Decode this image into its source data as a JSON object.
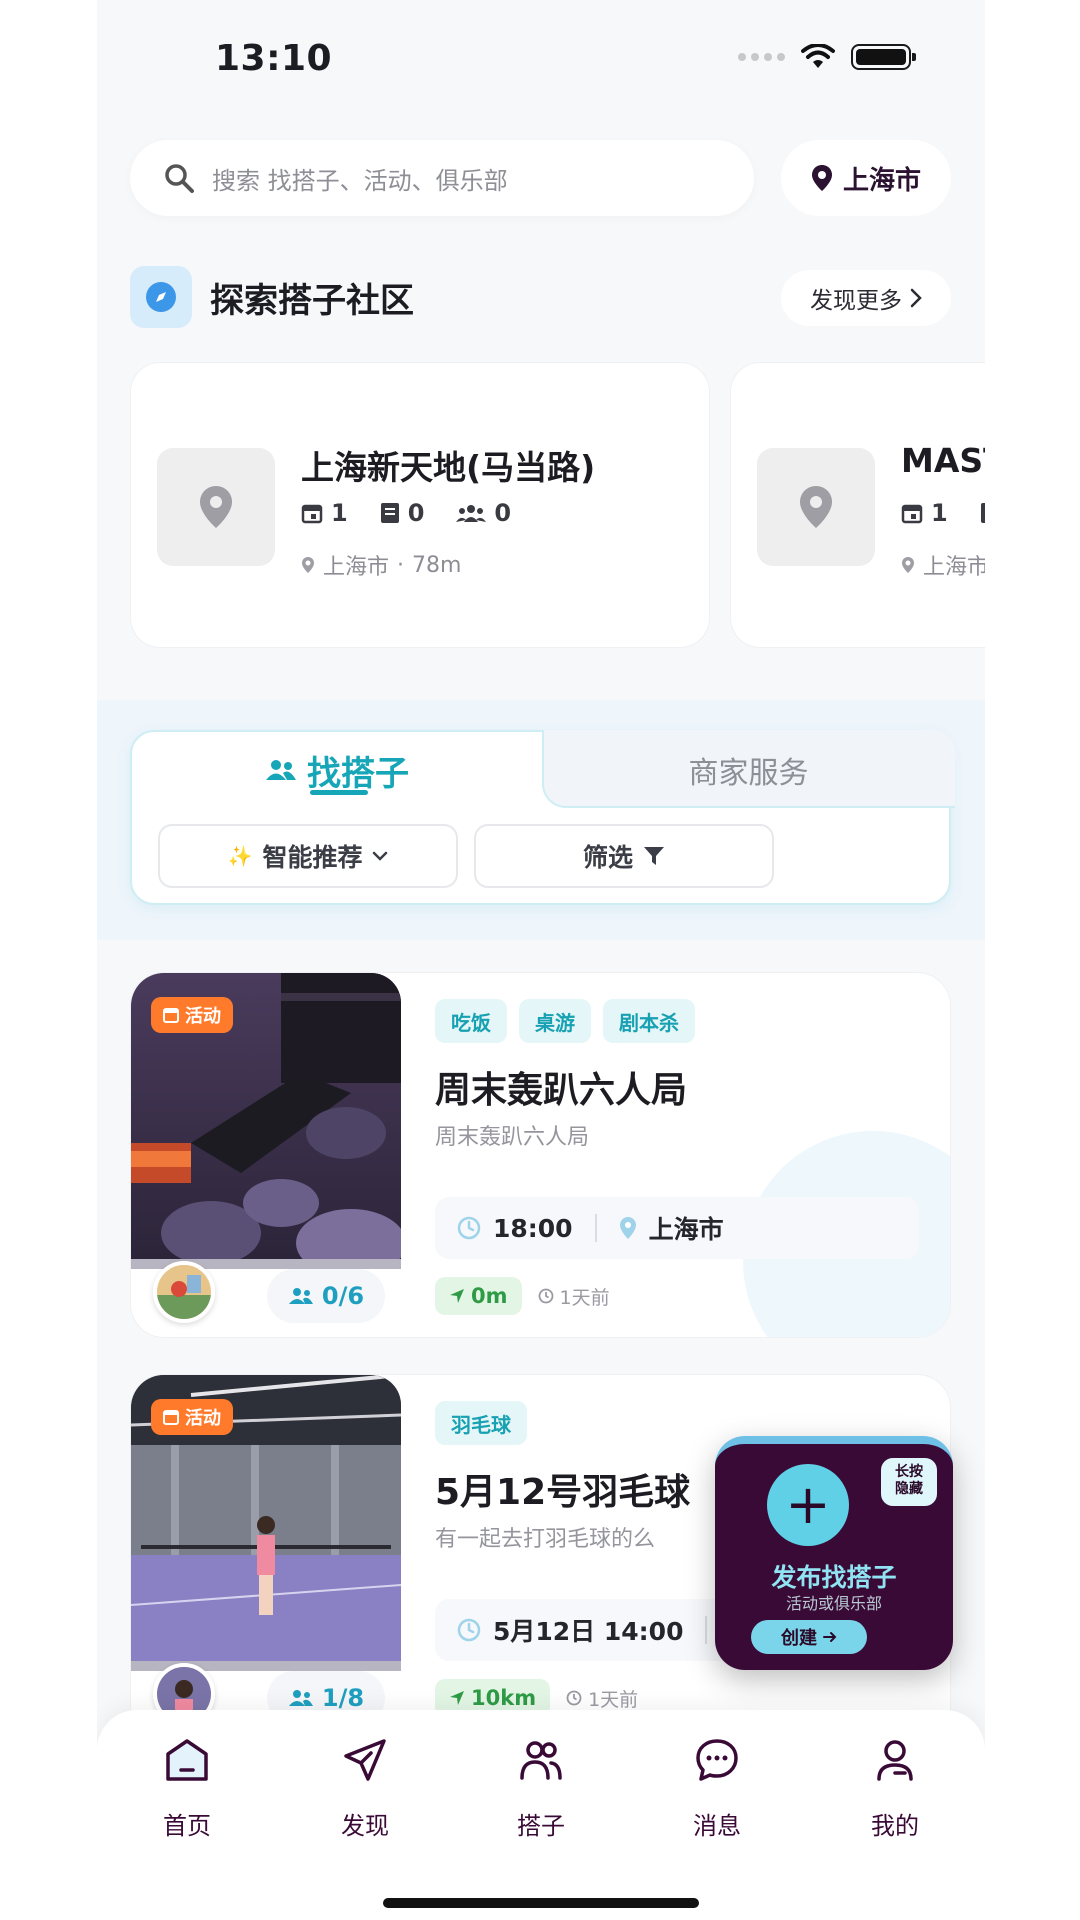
{
  "status": {
    "time": "13:10"
  },
  "search": {
    "placeholder": "搜索 找搭子、活动、俱乐部",
    "city": "上海市"
  },
  "explore": {
    "title": "探索搭子社区",
    "more_label": "发现更多"
  },
  "communities": [
    {
      "name": "上海新天地(马当路)",
      "events": "1",
      "posts": "0",
      "members": "0",
      "city": "上海市",
      "distance": "78m"
    },
    {
      "name": "MAST",
      "events": "1",
      "city": "上海市"
    }
  ],
  "tabs": {
    "active": "找搭子",
    "other": "商家服务"
  },
  "filters": {
    "recommend": "智能推荐",
    "filter": "筛选"
  },
  "activities": [
    {
      "badge": "活动",
      "tags": [
        "吃饭",
        "桌游",
        "剧本杀"
      ],
      "title": "周末轰趴六人局",
      "subtitle": "周末轰趴六人局",
      "time": "18:00",
      "location": "上海市",
      "distance": "0m",
      "posted": "1天前",
      "members": "0/6"
    },
    {
      "badge": "活动",
      "tags": [
        "羽毛球"
      ],
      "title": "5月12号羽毛球",
      "subtitle": "有一起去打羽毛球的么",
      "time": "5月12日 14:00",
      "distance": "10km",
      "posted": "1天前",
      "members": "1/8"
    }
  ],
  "publish": {
    "title": "发布找搭子",
    "subtitle": "活动或俱乐部",
    "create_label": "创建",
    "hint_line1": "长按",
    "hint_line2": "隐藏"
  },
  "nav": [
    {
      "label": "首页",
      "icon": "home-icon"
    },
    {
      "label": "发现",
      "icon": "paper-plane-icon"
    },
    {
      "label": "搭子",
      "icon": "people-icon"
    },
    {
      "label": "消息",
      "icon": "chat-icon"
    },
    {
      "label": "我的",
      "icon": "person-icon"
    }
  ],
  "colors": {
    "accent": "#16a6b8",
    "badge": "#ff7a2b",
    "fab": "#3a0a36",
    "nav_icon": "#3a0a36"
  }
}
